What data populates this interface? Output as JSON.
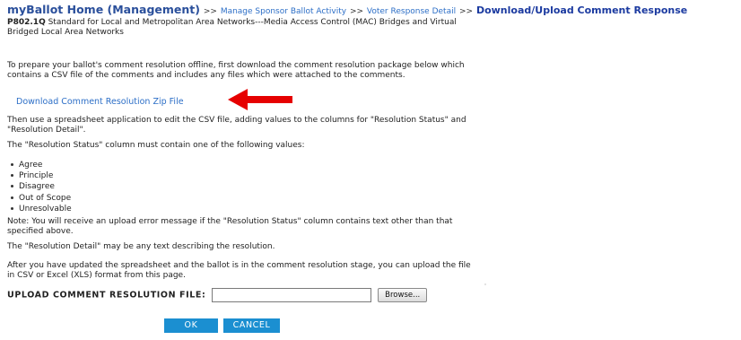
{
  "breadcrumb": {
    "home": "myBallot Home (Management)",
    "separator": ">>",
    "manage": "Manage Sponsor Ballot Activity",
    "voter": "Voter Response Detail",
    "current": "Download/Upload Comment Response"
  },
  "ballot": {
    "id": "P802.1Q",
    "title": "Standard for Local and Metropolitan Area Networks---Media Access Control (MAC) Bridges and Virtual Bridged Local Area Networks"
  },
  "text": {
    "intro": "To prepare your ballot's comment resolution offline, first download the comment resolution package below which contains a CSV file of the comments and includes any files which were attached to the comments.",
    "download_link": "Download Comment Resolution Zip File",
    "edit_instructions": "Then use a spreadsheet application to edit the CSV file, adding values to the columns for \"Resolution Status\" and \"Resolution Detail\".",
    "status_intro": "The \"Resolution Status\" column must contain one of the following values:",
    "note": "Note: You will receive an upload error message if the \"Resolution Status\" column contains text other than that specified above.",
    "detail_note": "The \"Resolution Detail\" may be any text describing the resolution.",
    "after_update": "After you have updated the spreadsheet and the ballot is in the comment resolution stage, you can upload the file in CSV or Excel (XLS) format from this page."
  },
  "status_values": [
    "Agree",
    "Principle",
    "Disagree",
    "Out of Scope",
    "Unresolvable"
  ],
  "upload": {
    "label": "UPLOAD COMMENT RESOLUTION FILE:",
    "browse": "Browse...",
    "value": ""
  },
  "buttons": {
    "ok": "OK",
    "cancel": "CANCEL"
  },
  "colors": {
    "arrow": "#e60000",
    "button": "#1b8fd1",
    "link": "#2d6fc7"
  },
  "icons": {
    "annotation_arrow": "left-arrow-icon"
  }
}
